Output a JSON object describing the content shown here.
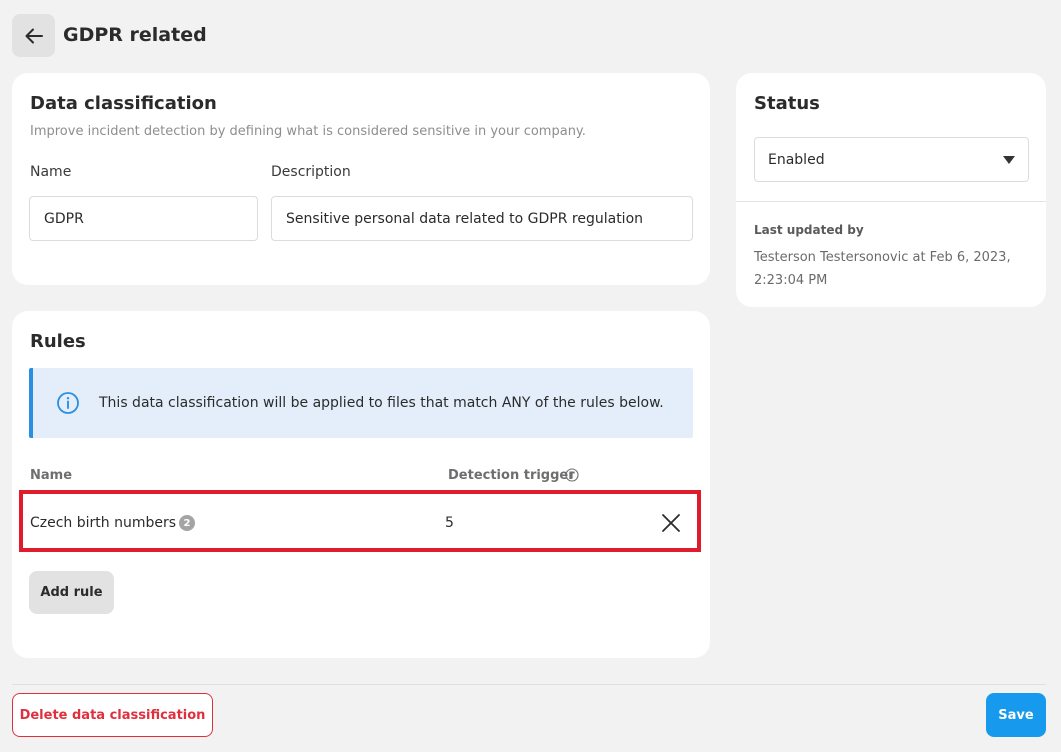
{
  "header": {
    "back_icon": "arrow-left-icon",
    "title": "GDPR related"
  },
  "classification": {
    "title": "Data classification",
    "subtitle": "Improve incident detection by defining what is considered sensitive in your company.",
    "name_label": "Name",
    "name_value": "GDPR",
    "description_label": "Description",
    "description_value": "Sensitive personal data related to GDPR regulation"
  },
  "rules": {
    "title": "Rules",
    "info_icon": "info-circle-icon",
    "info_text": "This data classification will be applied to files that match ANY of the rules below.",
    "columns": {
      "name": "Name",
      "trigger": "Detection trigger"
    },
    "items": [
      {
        "name": "Czech birth numbers",
        "badge": "2",
        "trigger": "5",
        "remove_icon": "close-icon"
      }
    ],
    "add_label": "Add rule"
  },
  "status": {
    "title": "Status",
    "selected": "Enabled",
    "updated_label": "Last updated by",
    "updated_value": "Testerson Testersonovic at Feb 6, 2023, 2:23:04 PM"
  },
  "footer": {
    "delete_label": "Delete data classification",
    "save_label": "Save"
  },
  "colors": {
    "background": "#f3f2f2",
    "accent": "#1799ee",
    "danger": "#e0303e",
    "highlight": "#e01b2b",
    "info_bg": "#e4eefa"
  }
}
